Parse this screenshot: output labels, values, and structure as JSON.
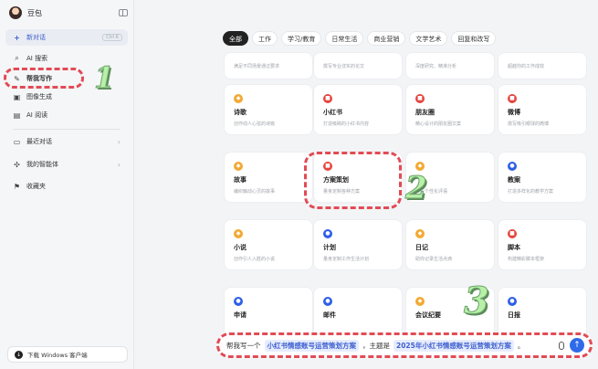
{
  "sidebar": {
    "app_name": "豆包",
    "new_chat": "新对话",
    "new_chat_shortcut": "Ctrl K",
    "items": [
      {
        "label": "AI 搜索",
        "icon": "search-icon"
      },
      {
        "label": "帮我写作",
        "icon": "pen-icon"
      },
      {
        "label": "图像生成",
        "icon": "image-icon"
      },
      {
        "label": "AI 阅读",
        "icon": "book-icon"
      }
    ],
    "groups": [
      {
        "label": "最近对话",
        "icon": "chat-icon"
      },
      {
        "label": "我的智能体",
        "icon": "agent-icon"
      },
      {
        "label": "收藏夹",
        "icon": "bookmark-icon"
      }
    ],
    "download": "下载 Windows 客户端"
  },
  "tabs": [
    "全部",
    "工作",
    "学习/教育",
    "日常生活",
    "商业营销",
    "文学艺术",
    "回复和改写"
  ],
  "top_cards": [
    {
      "desc": "满足不同场景通过要求"
    },
    {
      "desc": "撰写专业详实的论文"
    },
    {
      "desc": "深度研究、精准分析"
    },
    {
      "desc": "超越你的工作成效"
    }
  ],
  "cards": [
    {
      "title": "诗歌",
      "desc": "创作动人心弦的诗篇",
      "color": "orange",
      "icon": "poem-icon"
    },
    {
      "title": "小红书",
      "desc": "打造吸睛的小红书内容",
      "color": "red",
      "icon": "note-icon"
    },
    {
      "title": "朋友圈",
      "desc": "精心设计的朋友圈文案",
      "color": "red",
      "icon": "moments-icon"
    },
    {
      "title": "微博",
      "desc": "撰写吸引眼球的微博",
      "color": "red",
      "icon": "weibo-icon"
    },
    {
      "title": "故事",
      "desc": "编织触动心灵的故事",
      "color": "orange",
      "icon": "story-icon"
    },
    {
      "title": "方案策划",
      "desc": "量身定制各种方案",
      "color": "red",
      "icon": "plan-icon"
    },
    {
      "title": "",
      "desc": "撰写个性化评语",
      "color": "orange",
      "icon": "comment-icon"
    },
    {
      "title": "教案",
      "desc": "打造多样化的教学方案",
      "color": "blue",
      "icon": "lesson-icon"
    },
    {
      "title": "小说",
      "desc": "创作引人入胜的小说",
      "color": "orange",
      "icon": "novel-icon"
    },
    {
      "title": "计划",
      "desc": "量身定制工作生活计划",
      "color": "blue",
      "icon": "schedule-icon"
    },
    {
      "title": "日记",
      "desc": "助你记录生活点滴",
      "color": "orange",
      "icon": "diary-icon"
    },
    {
      "title": "脚本",
      "desc": "构建精彩脚本框架",
      "color": "red",
      "icon": "script-icon"
    },
    {
      "title": "申请",
      "desc": "",
      "color": "blue",
      "icon": "apply-icon"
    },
    {
      "title": "邮件",
      "desc": "",
      "color": "blue",
      "icon": "mail-icon"
    },
    {
      "title": "会议纪要",
      "desc": "",
      "color": "orange",
      "icon": "meeting-icon"
    },
    {
      "title": "日报",
      "desc": "",
      "color": "blue",
      "icon": "report-icon"
    }
  ],
  "input": {
    "prefix": "帮我写一个",
    "slot1": "小红书情感账号运营策划方案",
    "middle": "，主题是",
    "slot2": "2025年小红书情感账号运营策划方案",
    "suffix": "。"
  },
  "annotations": [
    "1",
    "2",
    "3"
  ],
  "colors": {
    "accent": "#3d5fcf",
    "highlight": "#e24b55",
    "send": "#2f6be8"
  }
}
